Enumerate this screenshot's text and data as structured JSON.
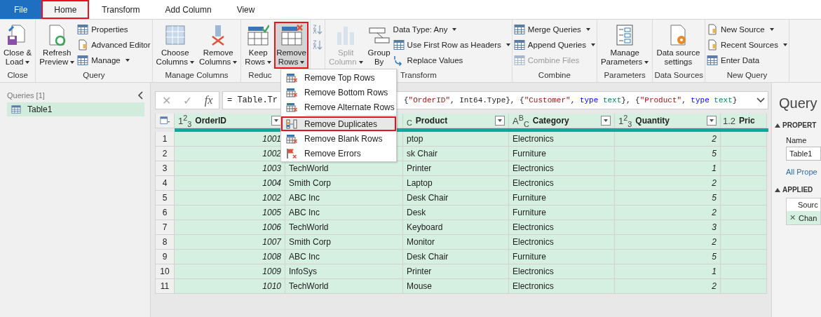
{
  "tabs": [
    {
      "label": "File",
      "kind": "file",
      "selected": false,
      "highlighted": false
    },
    {
      "label": "Home",
      "kind": "tab",
      "selected": true,
      "highlighted": true
    },
    {
      "label": "Transform",
      "kind": "tab",
      "selected": false,
      "highlighted": false
    },
    {
      "label": "Add Column",
      "kind": "tab",
      "selected": false,
      "highlighted": false
    },
    {
      "label": "View",
      "kind": "tab",
      "selected": false,
      "highlighted": false
    }
  ],
  "ribbon": {
    "groups": [
      {
        "label": "Close",
        "columns": [
          {
            "kind": "large",
            "buttons": [
              {
                "label": [
                  "Close &",
                  "Load"
                ],
                "dropdown": true,
                "disabled": false,
                "pressed": false,
                "highlighted": false
              }
            ]
          }
        ]
      },
      {
        "label": "Query",
        "columns": [
          {
            "kind": "large",
            "buttons": [
              {
                "label": [
                  "Refresh",
                  "Preview"
                ],
                "dropdown": true,
                "disabled": false,
                "pressed": false,
                "highlighted": false
              }
            ]
          },
          {
            "kind": "stack",
            "buttons": [
              {
                "label": [
                  "Properties"
                ],
                "dropdown": false,
                "disabled": false
              },
              {
                "label": [
                  "Advanced Editor"
                ],
                "dropdown": false,
                "disabled": false
              },
              {
                "label": [
                  "Manage"
                ],
                "dropdown": true,
                "disabled": false
              }
            ]
          }
        ]
      },
      {
        "label": "Manage Columns",
        "columns": [
          {
            "kind": "large",
            "buttons": [
              {
                "label": [
                  "Choose",
                  "Columns"
                ],
                "dropdown": true,
                "disabled": false,
                "pressed": false,
                "highlighted": false
              }
            ]
          },
          {
            "kind": "large",
            "buttons": [
              {
                "label": [
                  "Remove",
                  "Columns"
                ],
                "dropdown": true,
                "disabled": false,
                "pressed": false,
                "highlighted": false
              }
            ]
          }
        ]
      },
      {
        "label": "Reduc",
        "columns": [
          {
            "kind": "large",
            "buttons": [
              {
                "label": [
                  "Keep",
                  "Rows"
                ],
                "dropdown": true,
                "disabled": false,
                "pressed": false,
                "highlighted": false
              }
            ]
          },
          {
            "kind": "large",
            "buttons": [
              {
                "label": [
                  "Remove",
                  "Rows"
                ],
                "dropdown": true,
                "disabled": false,
                "pressed": true,
                "highlighted": true
              }
            ]
          }
        ]
      },
      {
        "columns": [
          {
            "kind": "stack",
            "buttons": [
              {
                "disabled": false
              },
              {
                "disabled": false
              }
            ]
          }
        ]
      },
      {
        "label": "Transform",
        "columns": [
          {
            "kind": "large",
            "buttons": [
              {
                "label": [
                  "Split",
                  "Column"
                ],
                "dropdown": true,
                "disabled": true,
                "pressed": false,
                "highlighted": false
              }
            ]
          },
          {
            "kind": "large",
            "buttons": [
              {
                "label": [
                  "Group",
                  "By"
                ],
                "dropdown": false,
                "disabled": false,
                "pressed": false,
                "highlighted": false
              }
            ]
          },
          {
            "kind": "stack",
            "buttons": [
              {
                "label": [
                  "Data Type: Any"
                ],
                "dropdown": true,
                "disabled": false
              },
              {
                "label": [
                  "Use First Row as Headers"
                ],
                "dropdown": true,
                "disabled": false
              },
              {
                "label": [
                  "Replace Values"
                ],
                "dropdown": false,
                "disabled": false
              }
            ]
          }
        ]
      },
      {
        "label": "Combine",
        "columns": [
          {
            "kind": "stack",
            "buttons": [
              {
                "label": [
                  "Merge Queries"
                ],
                "dropdown": true,
                "disabled": false
              },
              {
                "label": [
                  "Append Queries"
                ],
                "dropdown": true,
                "disabled": false
              },
              {
                "label": [
                  "Combine Files"
                ],
                "dropdown": false,
                "disabled": true
              }
            ]
          }
        ]
      },
      {
        "label": "Parameters",
        "columns": [
          {
            "kind": "large",
            "buttons": [
              {
                "label": [
                  "Manage",
                  "Parameters"
                ],
                "dropdown": true,
                "disabled": false,
                "pressed": false,
                "highlighted": false
              }
            ]
          }
        ]
      },
      {
        "label": "Data Sources",
        "columns": [
          {
            "kind": "large",
            "buttons": [
              {
                "label": [
                  "Data source",
                  "settings"
                ],
                "dropdown": false,
                "disabled": false,
                "pressed": false,
                "highlighted": false
              }
            ]
          }
        ]
      },
      {
        "label": "New Query",
        "columns": [
          {
            "kind": "stack",
            "buttons": [
              {
                "label": [
                  "New Source"
                ],
                "dropdown": true,
                "disabled": false
              },
              {
                "label": [
                  "Recent Sources"
                ],
                "dropdown": true,
                "disabled": false
              },
              {
                "label": [
                  "Enter Data"
                ],
                "dropdown": false,
                "disabled": false
              }
            ]
          }
        ]
      }
    ]
  },
  "remove_rows_menu": [
    {
      "kind": "item",
      "label": "Remove Top Rows",
      "selected": false,
      "highlighted": false
    },
    {
      "kind": "item",
      "label": "Remove Bottom Rows",
      "selected": false,
      "highlighted": false
    },
    {
      "kind": "item",
      "label": "Remove Alternate Rows",
      "selected": false,
      "highlighted": false
    },
    {
      "kind": "separator"
    },
    {
      "kind": "item",
      "label": "Remove Duplicates",
      "selected": true,
      "highlighted": true
    },
    {
      "kind": "item",
      "label": "Remove Blank Rows",
      "selected": false,
      "highlighted": false
    },
    {
      "kind": "item",
      "label": "Remove Errors",
      "selected": false,
      "highlighted": false
    }
  ],
  "queries_panel": {
    "title": "Queries [1]",
    "items": [
      {
        "label": "Table1",
        "selected": true
      }
    ]
  },
  "formula_bar": {
    "buttons": [
      "✕",
      "✓",
      "fx"
    ],
    "start": "= Table.Tr",
    "tokens": [
      {
        "text": "{",
        "kind": "plain"
      },
      {
        "text": "\"OrderID\"",
        "kind": "string"
      },
      {
        "text": ", Int64.Type}, {",
        "kind": "plain"
      },
      {
        "text": "\"Customer\"",
        "kind": "string"
      },
      {
        "text": ", ",
        "kind": "plain"
      },
      {
        "text": "type",
        "kind": "keyword"
      },
      {
        "text": " text",
        "kind": "type"
      },
      {
        "text": "}, {",
        "kind": "plain"
      },
      {
        "text": "\"Product\"",
        "kind": "string"
      },
      {
        "text": ", ",
        "kind": "plain"
      },
      {
        "text": "type",
        "kind": "keyword"
      },
      {
        "text": " text",
        "kind": "type"
      },
      {
        "text": "}",
        "kind": "plain"
      }
    ]
  },
  "table": {
    "columns": [
      {
        "type_label": "1$^{2}$$_{3}$",
        "label": "OrderID"
      },
      {},
      {
        "type_label": "$_{C}$",
        "label": "Product"
      },
      {
        "type_label": "A$^{B}$$_{C}$",
        "label": "Category"
      },
      {
        "type_label": "1$^{2}$$_{3}$",
        "label": "Quantity"
      },
      {
        "type_label": "1.2",
        "label": "Pric"
      }
    ],
    "rows": [
      {
        "number": "1",
        "cells": [
          "1001",
          null,
          "ptop",
          "Electronics",
          "2",
          null
        ]
      },
      {
        "number": "2",
        "cells": [
          "1002",
          null,
          "sk Chair",
          "Furniture",
          "5",
          null
        ]
      },
      {
        "number": "3",
        "cells": [
          "1003",
          "TechWorld",
          "Printer",
          "Electronics",
          "1",
          null
        ]
      },
      {
        "number": "4",
        "cells": [
          "1004",
          "Smith Corp",
          "Laptop",
          "Electronics",
          "2",
          null
        ]
      },
      {
        "number": "5",
        "cells": [
          "1002",
          "ABC Inc",
          "Desk Chair",
          "Furniture",
          "5",
          null
        ]
      },
      {
        "number": "6",
        "cells": [
          "1005",
          "ABC Inc",
          "Desk",
          "Furniture",
          "2",
          null
        ]
      },
      {
        "number": "7",
        "cells": [
          "1006",
          "TechWorld",
          "Keyboard",
          "Electronics",
          "3",
          null
        ]
      },
      {
        "number": "8",
        "cells": [
          "1007",
          "Smith Corp",
          "Monitor",
          "Electronics",
          "2",
          null
        ]
      },
      {
        "number": "9",
        "cells": [
          "1008",
          "ABC Inc",
          "Desk Chair",
          "Furniture",
          "5",
          null
        ]
      },
      {
        "number": "10",
        "cells": [
          "1009",
          "InfoSys",
          "Printer",
          "Electronics",
          "1",
          null
        ]
      },
      {
        "number": "11",
        "cells": [
          "1010",
          "TechWorld",
          "Mouse",
          "Electronics",
          "2",
          null
        ]
      }
    ]
  },
  "settings_panel": {
    "title": "Query",
    "properties_heading": "PROPERT",
    "name_label": "Name",
    "name_value": "Table1",
    "all_properties_link": "All Prope",
    "applied_heading": "APPLIED",
    "steps": [
      {
        "label": "Sourc",
        "selected": false
      },
      {
        "delete_glyph": "✕",
        "label": "Chan",
        "selected": true
      }
    ]
  }
}
